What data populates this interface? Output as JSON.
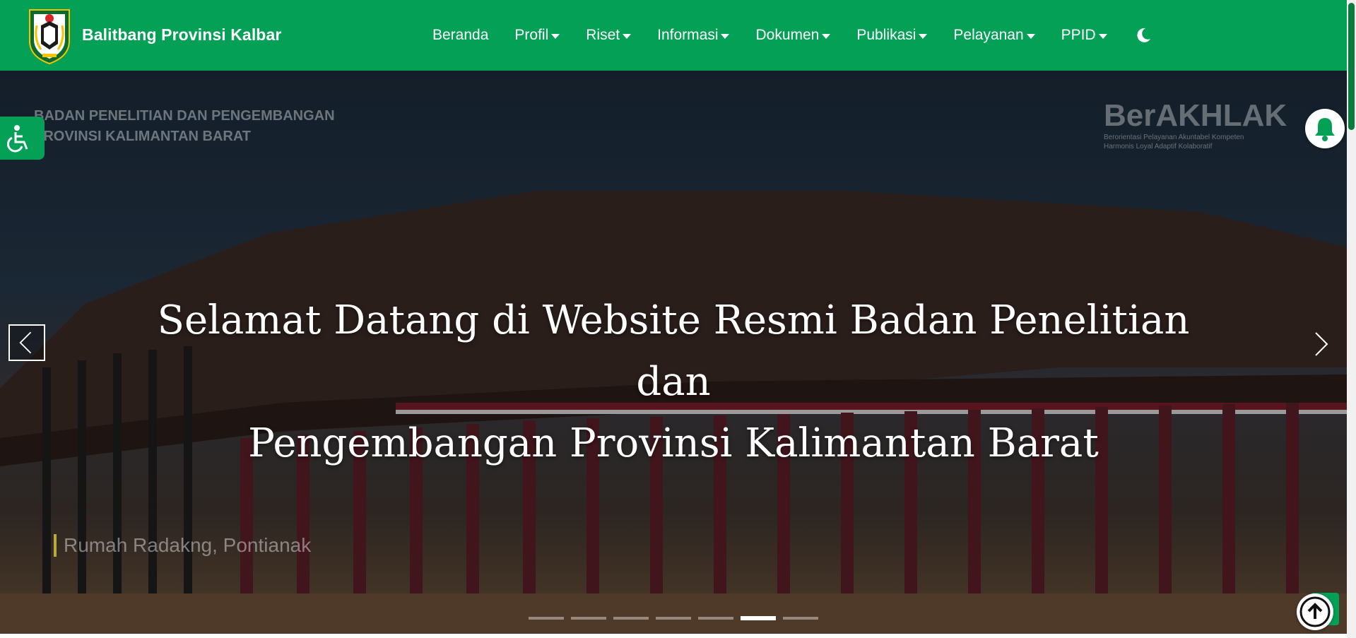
{
  "header": {
    "brand_name": "Balitbang Provinsi Kalbar",
    "brand_color": "#04a056",
    "logo_icon": "kalbar-provincial-emblem",
    "theme_toggle_icon": "moon-icon"
  },
  "nav": {
    "items": [
      {
        "label": "Beranda",
        "has_dropdown": false
      },
      {
        "label": "Profil",
        "has_dropdown": true
      },
      {
        "label": "Riset",
        "has_dropdown": true
      },
      {
        "label": "Informasi",
        "has_dropdown": true
      },
      {
        "label": "Dokumen",
        "has_dropdown": true
      },
      {
        "label": "Publikasi",
        "has_dropdown": true
      },
      {
        "label": "Pelayanan",
        "has_dropdown": true
      },
      {
        "label": "PPID",
        "has_dropdown": true
      }
    ]
  },
  "hero": {
    "title_line1": "Selamat Datang di Website Resmi Badan Penelitian dan",
    "title_line2": "Pengembangan Provinsi Kalimantan Barat",
    "watermark_left_line1": "BADAN PENELITIAN DAN PENGEMBANGAN",
    "watermark_left_line2": "PROVINSI KALIMANTAN BARAT",
    "watermark_right_title": "BerAKHLAK",
    "watermark_right_line1": "Berorientasi Pelayanan Akuntabel Kompeten",
    "watermark_right_line2": "Harmonis Loyal Adaptif Kolaboratif",
    "photo_caption": "Rumah Radakng, Pontianak",
    "slide_count": 7,
    "active_slide": 6
  },
  "floating": {
    "accessibility_icon": "wheelchair-icon",
    "notification_icon": "bell-icon",
    "back_to_top_icon": "arrow-up-icon"
  }
}
